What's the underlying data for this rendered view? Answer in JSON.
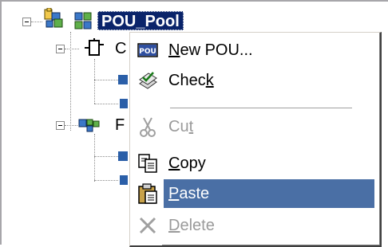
{
  "tree": {
    "root_label": "POU_Pool",
    "child1_partial": "C",
    "child2_partial": "F"
  },
  "context_menu": {
    "items": [
      {
        "label": "New POU...",
        "accel": "N",
        "icon": "pou-icon",
        "enabled": true,
        "selected": false
      },
      {
        "label": "Check",
        "accel": "k",
        "icon": "check-icon",
        "enabled": true,
        "selected": false
      },
      {
        "label": "Cut",
        "accel": "t",
        "icon": "scissors-icon",
        "enabled": false,
        "selected": false
      },
      {
        "label": "Copy",
        "accel": "C",
        "icon": "copy-icon",
        "enabled": true,
        "selected": false
      },
      {
        "label": "Paste",
        "accel": "P",
        "icon": "paste-icon",
        "enabled": true,
        "selected": true
      },
      {
        "label": "Delete",
        "accel": "D",
        "icon": "delete-icon",
        "enabled": false,
        "selected": false
      }
    ]
  },
  "colors": {
    "selection_bg": "#0a246a",
    "menu_highlight": "#4a6fa5",
    "disabled_text": "#9a9a9a"
  }
}
